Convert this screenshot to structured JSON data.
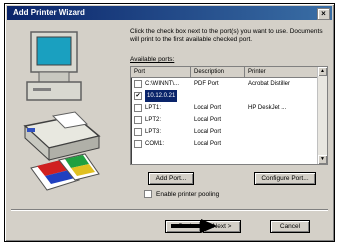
{
  "window": {
    "title": "Add Printer Wizard",
    "close_glyph": "×"
  },
  "instructions": "Click the check box next to the port(s) you want to use. Documents will print to the first available checked port.",
  "ports": {
    "label": "Available ports:",
    "columns": [
      "Port",
      "Description",
      "Printer"
    ],
    "rows": [
      {
        "port": "C:\\WINNT\\...",
        "description": "PDF Port",
        "printer": "Acrobat Distiller",
        "checked": false,
        "selected": false
      },
      {
        "port": "10.12.0.21",
        "description": "",
        "printer": "",
        "checked": true,
        "selected": true
      },
      {
        "port": "LPT1:",
        "description": "Local Port",
        "printer": "HP DeskJet ...",
        "checked": false,
        "selected": false
      },
      {
        "port": "LPT2:",
        "description": "Local Port",
        "printer": "",
        "checked": false,
        "selected": false
      },
      {
        "port": "LPT3:",
        "description": "Local Port",
        "printer": "",
        "checked": false,
        "selected": false
      },
      {
        "port": "COM1:",
        "description": "Local Port",
        "printer": "",
        "checked": false,
        "selected": false
      }
    ]
  },
  "buttons": {
    "add_port": "Add Port...",
    "configure_port": "Configure Port...",
    "back": "< Back",
    "next": "Next >",
    "cancel": "Cancel"
  },
  "pooling": {
    "label": "Enable printer pooling",
    "checked": false
  },
  "icons": {
    "check": "✔",
    "scroll_up": "▲",
    "scroll_down": "▼"
  },
  "colors": {
    "titlebar": "#0a246a",
    "selection": "#0a246a",
    "face": "#d4d0c8"
  }
}
